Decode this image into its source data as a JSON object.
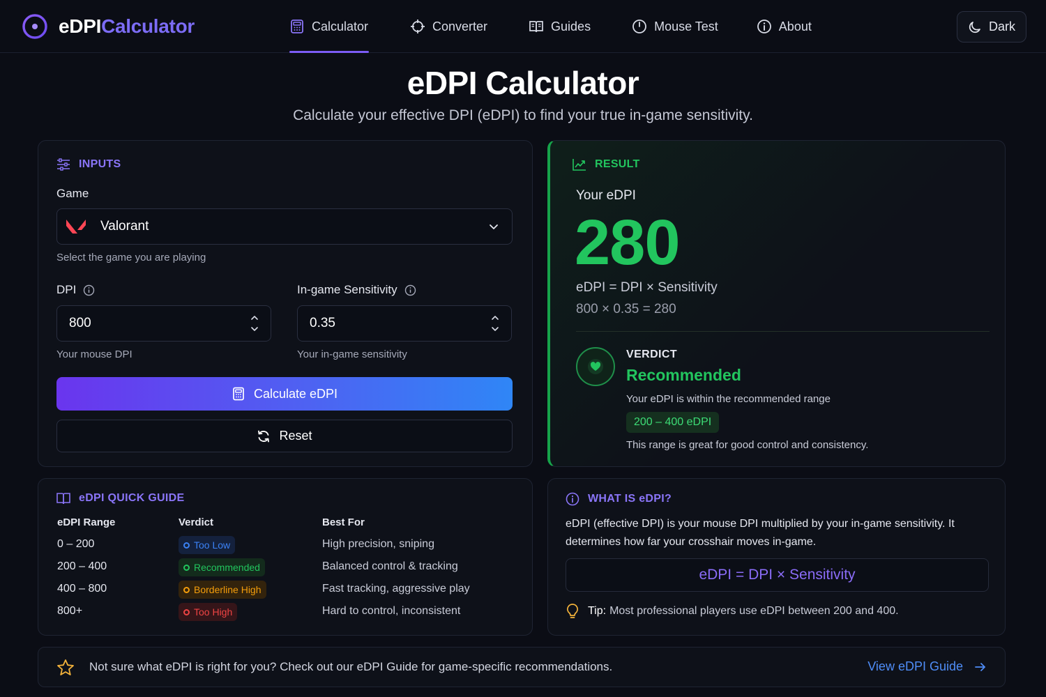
{
  "brand": {
    "name_part1": "eDPI",
    "name_part2": "Calculator"
  },
  "nav": {
    "items": [
      {
        "label": "Calculator",
        "icon": "calculator-icon",
        "active": true
      },
      {
        "label": "Converter",
        "icon": "crosshair-icon"
      },
      {
        "label": "Guides",
        "icon": "book-icon"
      },
      {
        "label": "Mouse Test",
        "icon": "mouse-icon"
      },
      {
        "label": "About",
        "icon": "info-icon"
      }
    ],
    "theme_label": "Dark"
  },
  "header": {
    "title": "eDPI Calculator",
    "subtitle": "Calculate your effective DPI (eDPI) to find your true in-game sensitivity."
  },
  "inputs": {
    "heading": "INPUTS",
    "game_label": "Game",
    "game_value": "Valorant",
    "game_hint": "Select the game you are playing",
    "dpi_label": "DPI",
    "dpi_value": "800",
    "dpi_hint": "Your mouse DPI",
    "sens_label": "In-game Sensitivity",
    "sens_value": "0.35",
    "sens_hint": "Your in-game sensitivity",
    "calculate_label": "Calculate eDPI",
    "reset_label": "Reset"
  },
  "result": {
    "heading": "RESULT",
    "your_label": "Your eDPI",
    "value": "280",
    "formula": "eDPI = DPI × Sensitivity",
    "calculation": "800 × 0.35 = 280",
    "verdict_caption": "VERDICT",
    "verdict": "Recommended",
    "verdict_desc": "Your eDPI is within the recommended range",
    "range": "200 – 400 eDPI",
    "range_note": "This range is great for good control and consistency."
  },
  "guide": {
    "heading": "eDPI QUICK GUIDE",
    "columns": [
      "eDPI Range",
      "Verdict",
      "Best For"
    ],
    "rows": [
      {
        "range": "0 – 200",
        "verdict": "Too Low",
        "best": "High precision, sniping"
      },
      {
        "range": "200 – 400",
        "verdict": "Recommended",
        "best": "Balanced control & tracking"
      },
      {
        "range": "400 – 800",
        "verdict": "Borderline High",
        "best": "Fast tracking, aggressive play"
      },
      {
        "range": "800+",
        "verdict": "Too High",
        "best": "Hard to control, inconsistent"
      }
    ]
  },
  "what": {
    "heading": "WHAT IS eDPI?",
    "description": "eDPI (effective DPI) is your mouse DPI multiplied by your in-game sensitivity. It determines how far your crosshair moves in-game.",
    "formula": "eDPI = DPI × Sensitivity",
    "tip_label": "Tip:",
    "tip_text": "Most professional players use eDPI between 200 and 400."
  },
  "banner": {
    "text": "Not sure what eDPI is right for you? Check out our eDPI Guide for game-specific recommendations.",
    "link": "View eDPI Guide"
  },
  "colors": {
    "accent": "#7c5cf5",
    "success": "#22c55e",
    "too_low": "#3b82f6",
    "recommended": "#22c55e",
    "borderline": "#f59e0b",
    "too_high": "#ef4444",
    "link": "#4f8df7"
  }
}
